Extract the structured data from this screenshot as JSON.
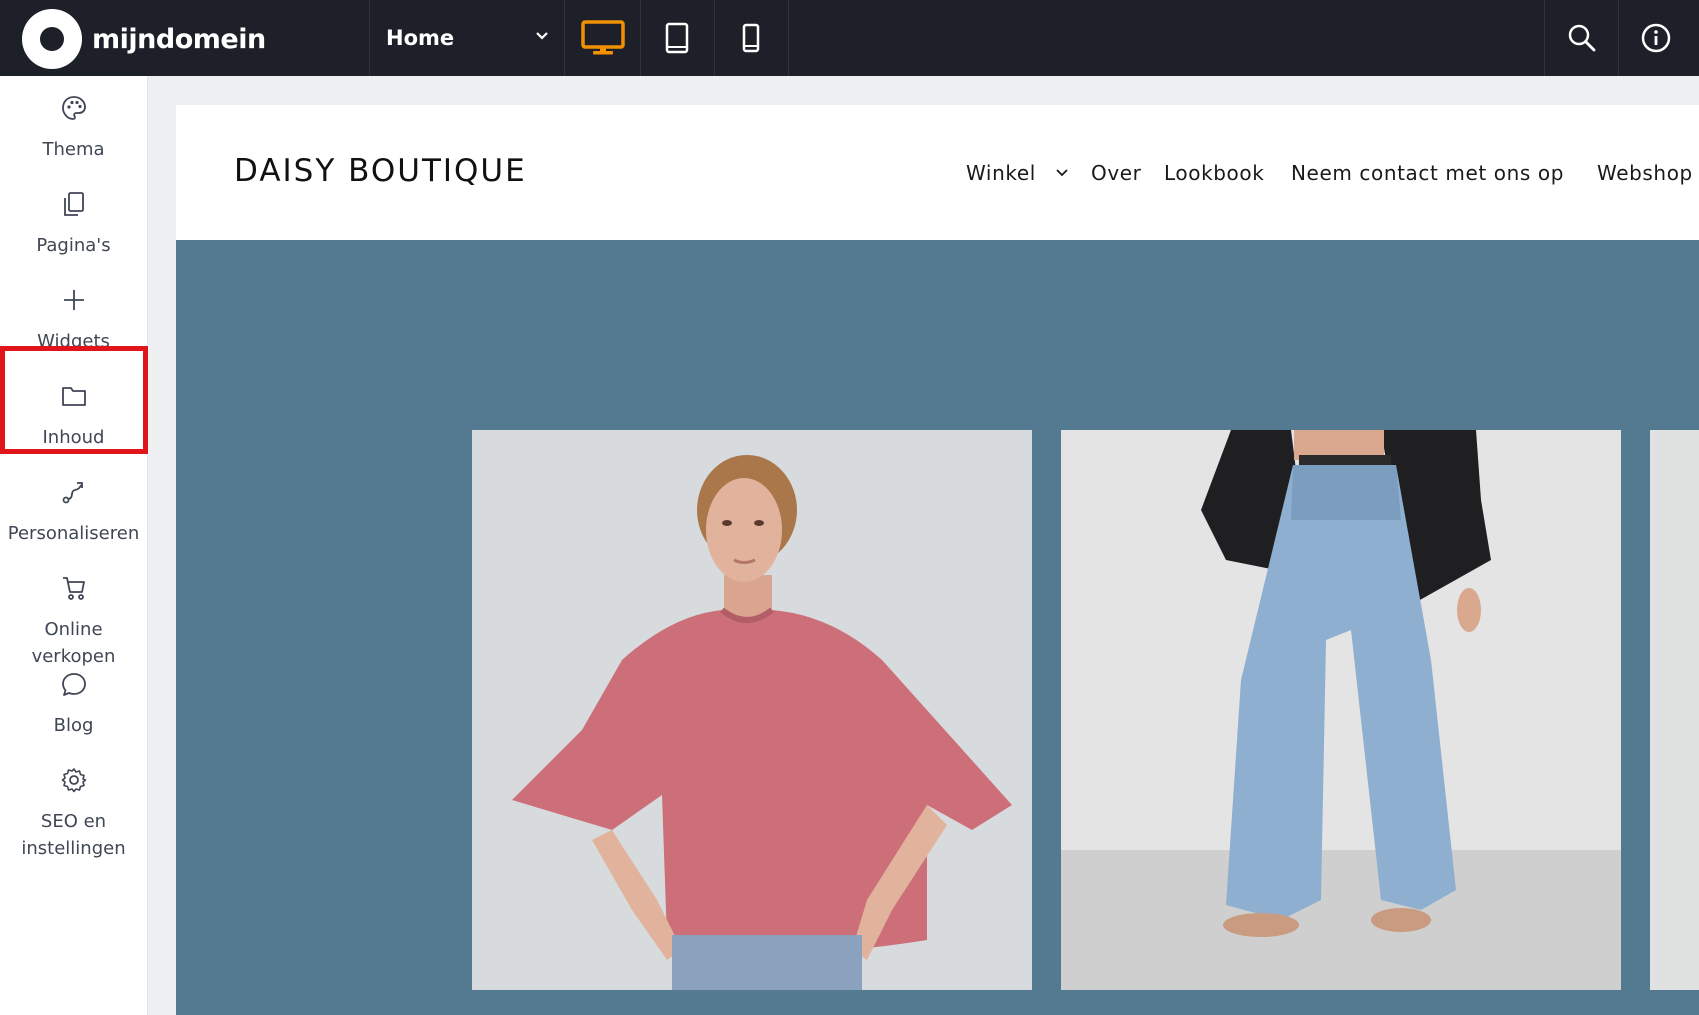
{
  "topbar": {
    "logo_text": "mijndomein",
    "page_select_value": "Home",
    "device_desktop_color": "#f29100",
    "icons": [
      "desktop-icon",
      "tablet-icon",
      "mobile-icon",
      "search-icon",
      "info-icon"
    ]
  },
  "sidebar": {
    "items": [
      {
        "label": "Thema",
        "icon": "palette-icon"
      },
      {
        "label": "Pagina's",
        "icon": "pages-icon"
      },
      {
        "label": "Widgets",
        "icon": "plus-icon"
      },
      {
        "label": "Inhoud",
        "icon": "folder-icon"
      },
      {
        "label": "Personaliseren",
        "icon": "route-icon"
      },
      {
        "label": "Online verkopen",
        "icon": "cart-icon"
      },
      {
        "label": "Blog",
        "icon": "chat-bubble-icon"
      },
      {
        "label": "SEO en instellingen",
        "icon": "gear-icon"
      }
    ],
    "highlight_color": "#e1141b"
  },
  "site": {
    "brand": "DAISY BOUTIQUE",
    "nav": [
      "Winkel",
      "Over",
      "Lookbook",
      "Neem contact met ons op",
      "Webshop"
    ],
    "hero_color": "#537a90"
  }
}
